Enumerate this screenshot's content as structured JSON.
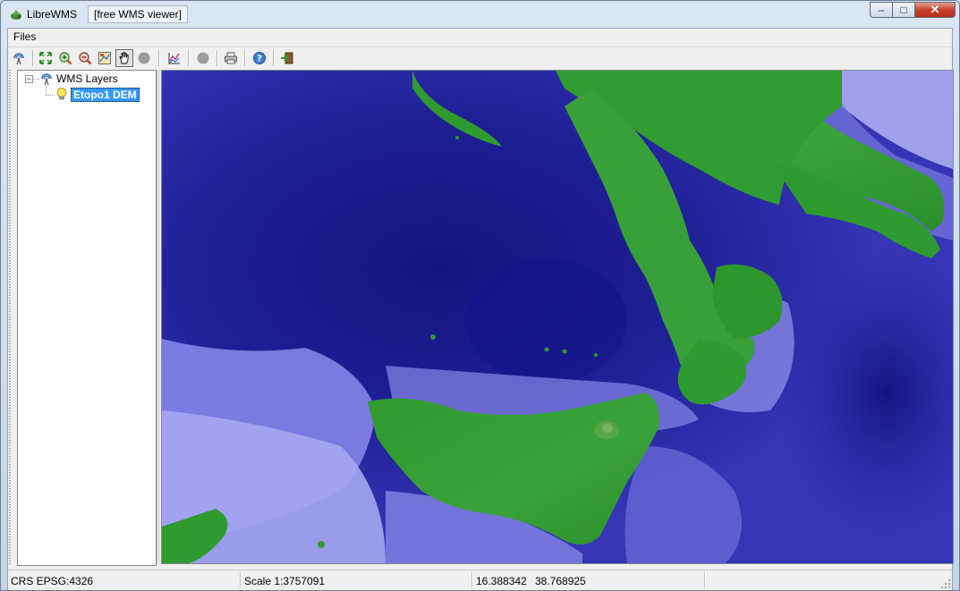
{
  "window": {
    "app_name": "LibreWMS",
    "subtitle": "[free WMS viewer]",
    "minimize_glyph": "–",
    "maximize_glyph": "□",
    "close_glyph": "✕"
  },
  "menu": {
    "files": "Files"
  },
  "toolbar": {
    "buttons": [
      "wms-connect-icon",
      "zoom-full-icon",
      "zoom-in-icon",
      "zoom-out-icon",
      "zoom-box-icon",
      "pan-hand-icon",
      "stop-icon",
      "graph-icon",
      "record-icon",
      "print-icon",
      "help-icon",
      "exit-icon"
    ],
    "active": "pan-hand-icon"
  },
  "tree": {
    "root": {
      "label": "WMS Layers",
      "expander": "−"
    },
    "layers": [
      {
        "label": "Etopo1 DEM",
        "selected": true
      }
    ]
  },
  "status": {
    "crs": "CRS EPSG:4326",
    "scale": "Scale 1:3757091",
    "lon": "16.388342",
    "lat": "38.768925"
  },
  "colors": {
    "deep_sea": "#1a1a8c",
    "shallow_sea": "#8a8aec",
    "land": "#2f9a2f",
    "selection": "#3399ff"
  }
}
